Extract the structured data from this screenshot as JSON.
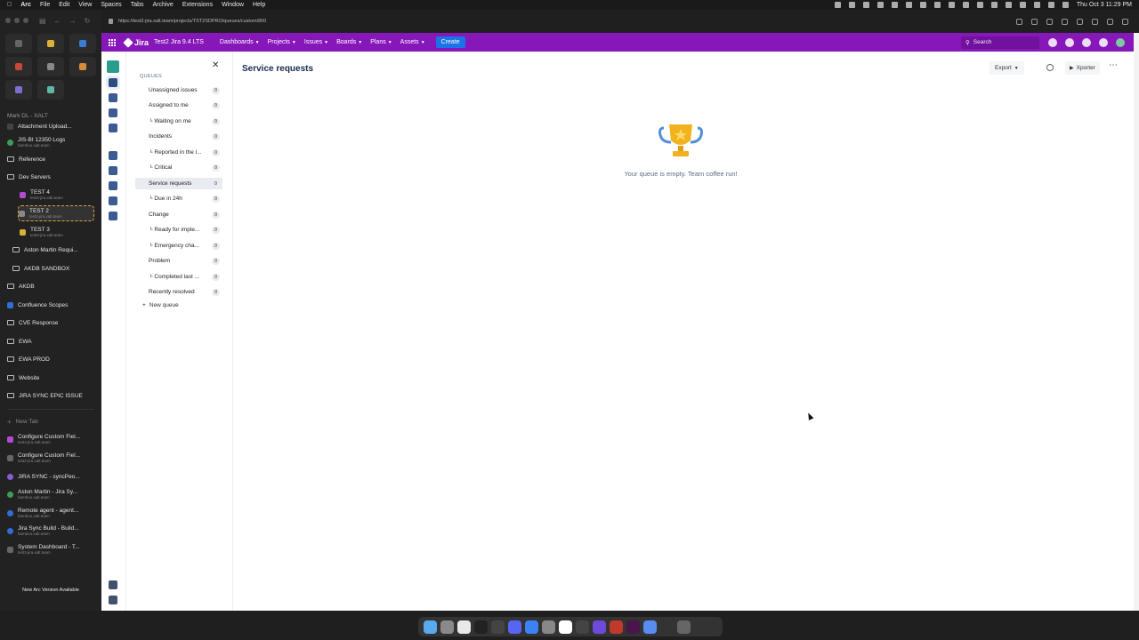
{
  "menubar": {
    "apple": "",
    "items": [
      "Arc",
      "File",
      "Edit",
      "View",
      "Spaces",
      "Tabs",
      "Archive",
      "Extensions",
      "Window",
      "Help"
    ],
    "clock": "Thu Oct 3  11:29 PM"
  },
  "arc": {
    "sections": [
      {
        "label": "Mark DL - XALT",
        "sub": ""
      },
      {
        "label": "Attachment Upload...",
        "sub": ""
      },
      {
        "label": "JIS-BI 12350 Logs",
        "sub": "bamboo.xalt.team"
      },
      {
        "label": "Reference",
        "sub": ""
      },
      {
        "label": "Dev Servers",
        "sub": ""
      },
      {
        "label": "TEST 4",
        "sub": "test4-jira.xalt.team"
      },
      {
        "label": "TEST 2",
        "sub": "test2-jira.xalt.team"
      },
      {
        "label": "TEST 3",
        "sub": "test3-jira.xalt.team"
      },
      {
        "label": "Aston Martin Requi...",
        "sub": ""
      },
      {
        "label": "AKDB SANDBOX",
        "sub": ""
      },
      {
        "label": "AKDB",
        "sub": ""
      },
      {
        "label": "Confluence Scopes",
        "sub": ""
      },
      {
        "label": "CVE Response",
        "sub": ""
      },
      {
        "label": "EWA",
        "sub": ""
      },
      {
        "label": "EWA PROD",
        "sub": ""
      },
      {
        "label": "Website",
        "sub": ""
      },
      {
        "label": "JIRA SYNC EPIC ISSUE",
        "sub": ""
      }
    ],
    "new_tab": "New Tab",
    "tabs": [
      {
        "label": "Configure Custom Fiel...",
        "sub": "test4-jira.xalt.team"
      },
      {
        "label": "Configure Custom Fiel...",
        "sub": "test2-jira.xalt.team"
      },
      {
        "label": "JIRA SYNC - syncPeo...",
        "sub": ""
      },
      {
        "label": "Aston Martin - Jira Sy...",
        "sub": "bamboo.xalt.team"
      },
      {
        "label": "Remote agent - agent...",
        "sub": "bamboo.xalt.team"
      },
      {
        "label": "Jira Sync Build - Build...",
        "sub": "bamboo.xalt.team"
      },
      {
        "label": "System Dashboard - T...",
        "sub": "test2-jira.xalt.team"
      }
    ],
    "banner": "New Arc Version Available"
  },
  "browser": {
    "url": "https://test2-jira.xalt.team/projects/TST2SDPRO/queues/custom/800"
  },
  "jira": {
    "product": "Jira",
    "instance": "Test2 Jira 9.4 LTS",
    "nav": [
      "Dashboards",
      "Projects",
      "Issues",
      "Boards",
      "Plans",
      "Assets"
    ],
    "create": "Create",
    "search_placeholder": "Search",
    "colors": {
      "topnav": "#8617b8",
      "create": "#1b73e8"
    }
  },
  "queues": {
    "heading": "QUEUES",
    "items": [
      {
        "label": "Unassigned issues",
        "count": "0"
      },
      {
        "label": "Assigned to me",
        "count": "0"
      },
      {
        "label": "└ Waiting on me",
        "count": "0"
      },
      {
        "label": "Incidents",
        "count": "0"
      },
      {
        "label": "└ Reported in the l...",
        "count": "0"
      },
      {
        "label": "└ Critical",
        "count": "0"
      },
      {
        "label": "Service requests",
        "count": "0"
      },
      {
        "label": "└ Due in 24h",
        "count": "0"
      },
      {
        "label": "Change",
        "count": "0"
      },
      {
        "label": "└ Ready for imple...",
        "count": "0"
      },
      {
        "label": "└ Emergency cha...",
        "count": "0"
      },
      {
        "label": "Problem",
        "count": "0"
      },
      {
        "label": "└ Completed last ...",
        "count": "0"
      },
      {
        "label": "Recently resolved",
        "count": "0"
      }
    ],
    "new_queue": "New queue"
  },
  "main": {
    "title": "Service requests",
    "export": "Export",
    "xporter": "Xporter",
    "empty_message": "Your queue is empty. Team coffee run!"
  }
}
